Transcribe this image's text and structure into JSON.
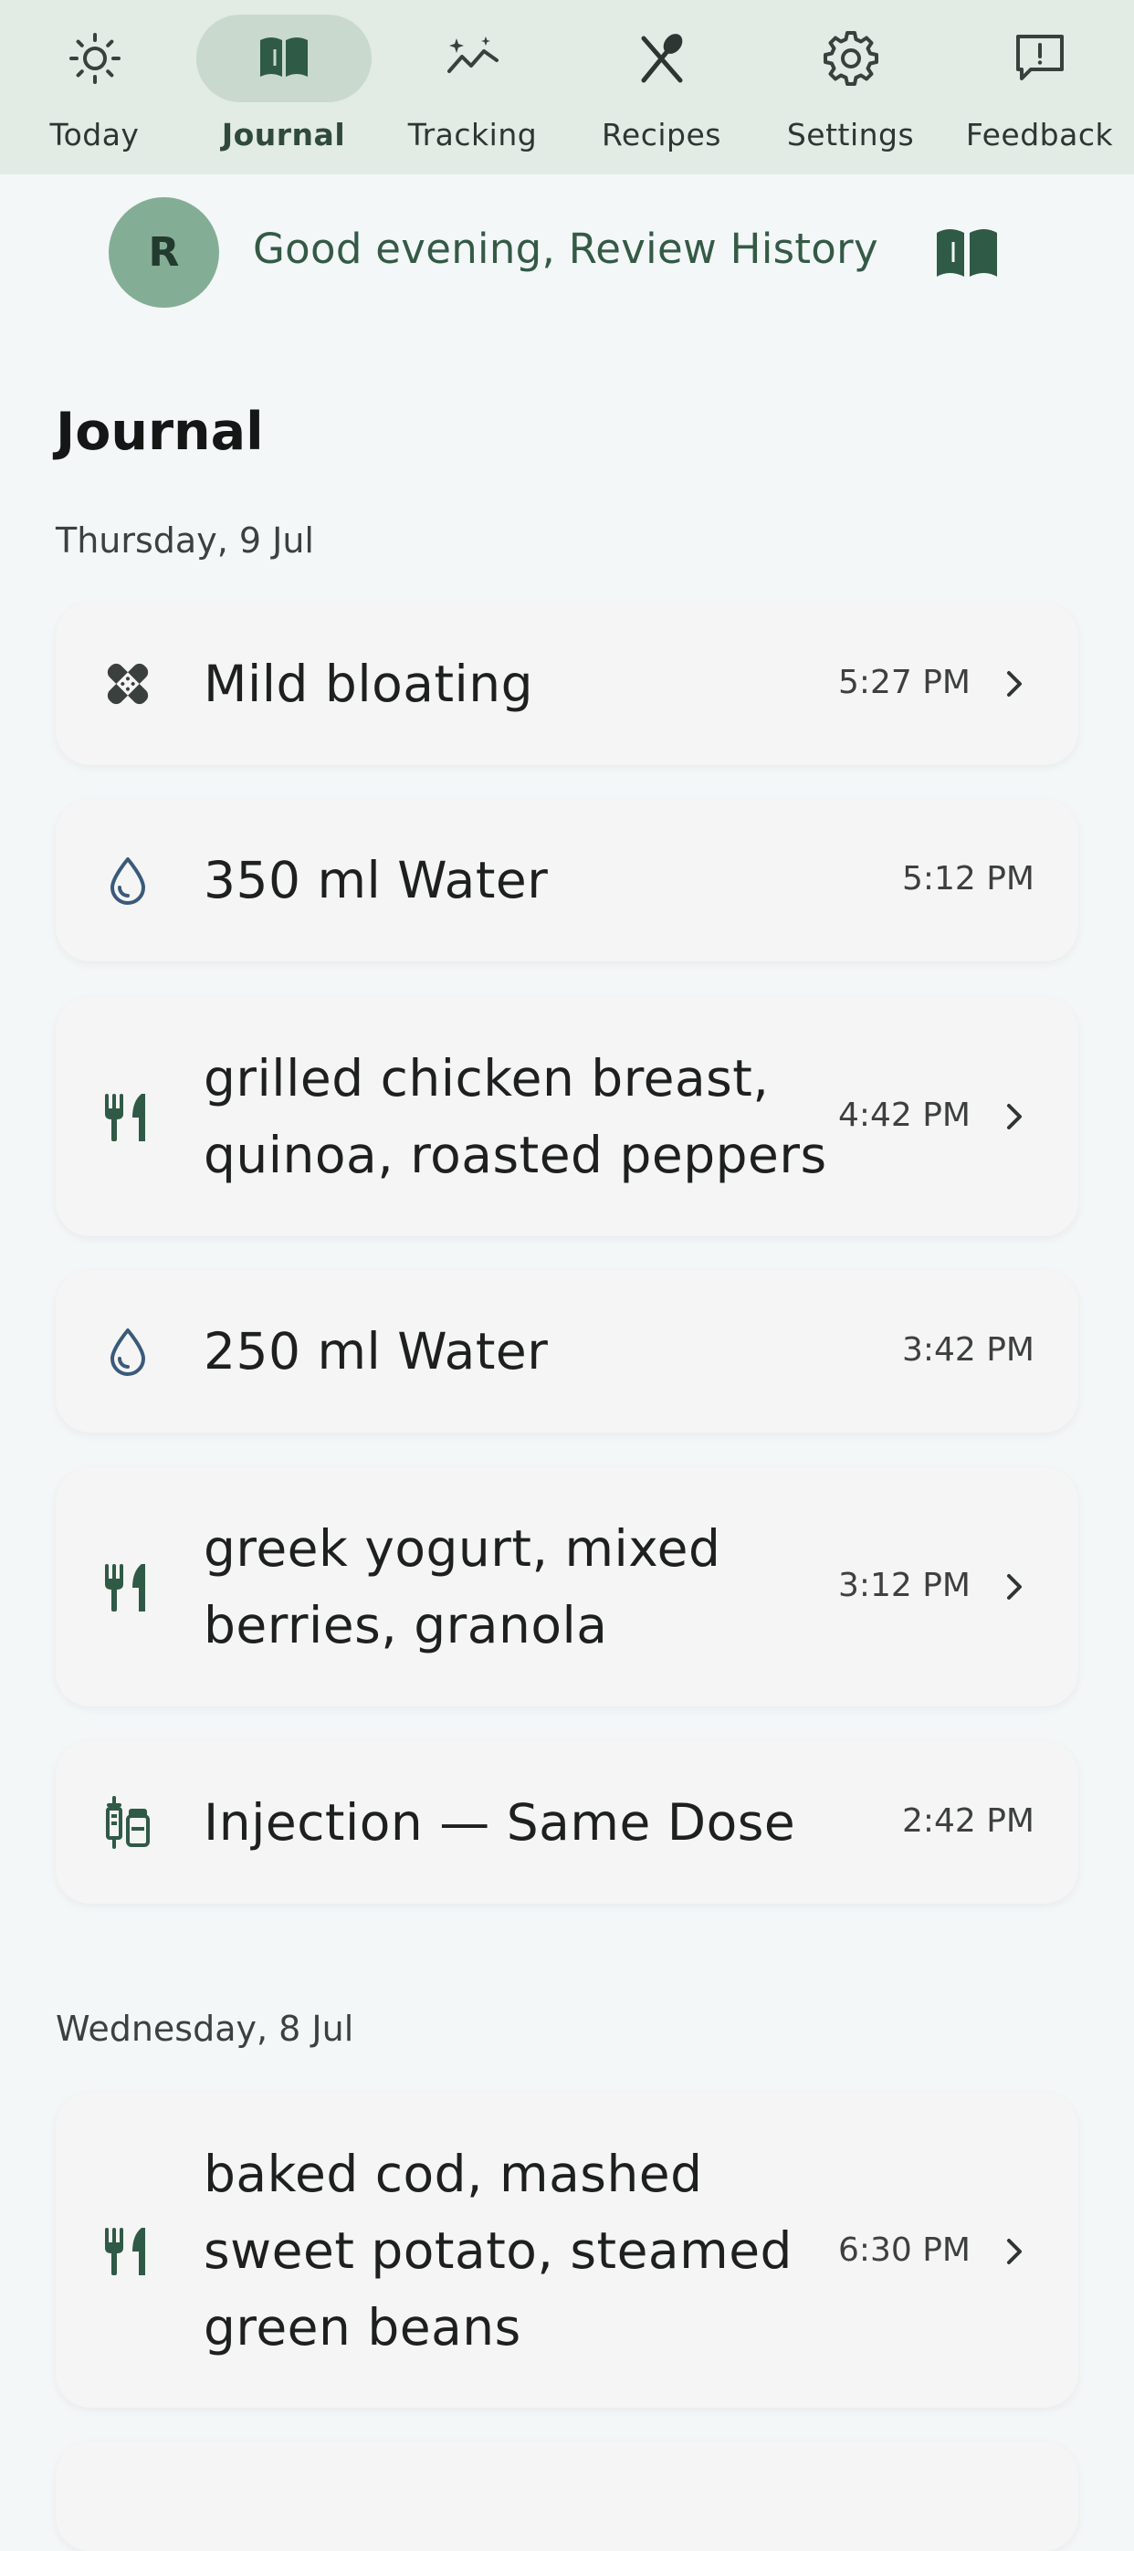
{
  "nav": {
    "items": [
      {
        "label": "Today",
        "icon": "sun-icon"
      },
      {
        "label": "Journal",
        "icon": "book-open-icon",
        "active": true
      },
      {
        "label": "Tracking",
        "icon": "trend-sparkle-icon"
      },
      {
        "label": "Recipes",
        "icon": "fork-spoon-icon"
      },
      {
        "label": "Settings",
        "icon": "gear-icon"
      },
      {
        "label": "Feedback",
        "icon": "feedback-icon"
      }
    ]
  },
  "header": {
    "avatar_initial": "R",
    "greeting": "Good evening, Review History",
    "icon": "book-open-icon"
  },
  "journal": {
    "title": "Journal",
    "days": [
      {
        "heading": "Thursday, 9 Jul",
        "entries": [
          {
            "type": "symptom",
            "icon": "bandage-icon",
            "title": "Mild bloating",
            "time": "5:27 PM",
            "has_chevron": true
          },
          {
            "type": "water",
            "icon": "water-drop-icon",
            "title": "350 ml Water",
            "time": "5:12 PM",
            "has_chevron": false
          },
          {
            "type": "meal",
            "icon": "utensils-icon",
            "title": "grilled chicken breast, quinoa, roasted peppers",
            "time": "4:42 PM",
            "has_chevron": true
          },
          {
            "type": "water",
            "icon": "water-drop-icon",
            "title": "250 ml Water",
            "time": "3:42 PM",
            "has_chevron": false
          },
          {
            "type": "meal",
            "icon": "utensils-icon",
            "title": "greek yogurt, mixed berries, granola",
            "time": "3:12 PM",
            "has_chevron": true
          },
          {
            "type": "injection",
            "icon": "syringe-vial-icon",
            "title": "Injection — Same Dose",
            "time": "2:42 PM",
            "has_chevron": false
          }
        ]
      },
      {
        "heading": "Wednesday, 8 Jul",
        "entries": [
          {
            "type": "meal",
            "icon": "utensils-icon",
            "title": "baked cod, mashed sweet potato, steamed green beans",
            "time": "6:30 PM",
            "has_chevron": true
          }
        ]
      }
    ]
  },
  "colors": {
    "nav_bg": "#e2ebe4",
    "nav_active_pill": "#c9d9ce",
    "accent_green": "#2f5a45",
    "avatar_bg": "#84ad95",
    "water_blue": "#3a5a7a",
    "page_bg": "#f3f7f8",
    "card_bg": "#f5f5f5"
  }
}
